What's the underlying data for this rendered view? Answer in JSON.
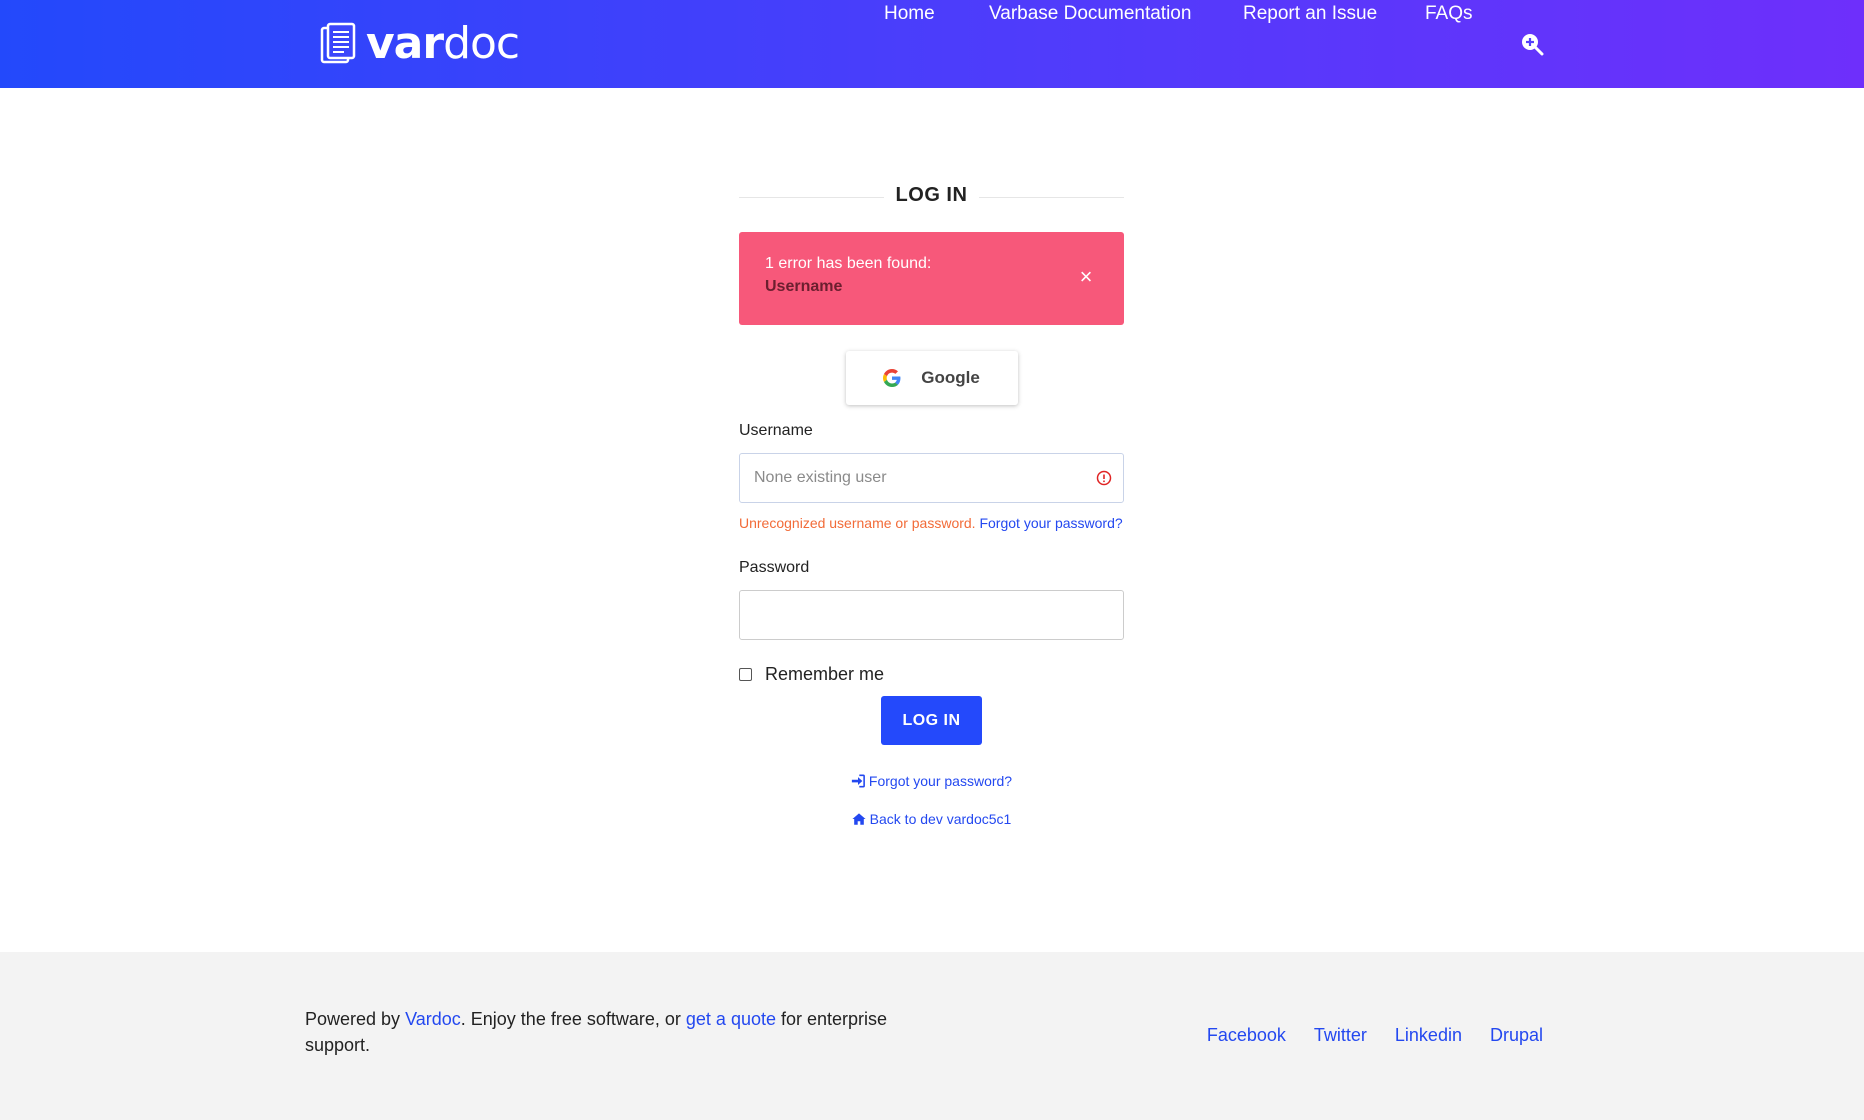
{
  "header": {
    "logo_bold": "var",
    "logo_light": "doc",
    "nav": [
      {
        "label": "Home"
      },
      {
        "label": "Varbase Documentation"
      },
      {
        "label": "Report an Issue"
      },
      {
        "label": "FAQs"
      }
    ],
    "search_icon": "search-plus-icon"
  },
  "login": {
    "title": "LOG IN",
    "alert": {
      "message": "1 error has been found:",
      "field": "Username",
      "close_symbol": "×"
    },
    "google_label": "Google",
    "username": {
      "label": "Username",
      "placeholder": "None existing user",
      "value": ""
    },
    "username_error": "Unrecognized username or password.",
    "username_error_link": "Forgot your password?",
    "password": {
      "label": "Password",
      "value": ""
    },
    "remember_label": "Remember me",
    "remember_checked": false,
    "submit_label": "LOG IN",
    "links": [
      {
        "label": "Forgot your password?",
        "icon": "sign-in-icon"
      },
      {
        "label": "Back to dev vardoc5c1",
        "icon": "home-icon"
      }
    ]
  },
  "footer": {
    "text_prefix": "Powered by",
    "vardoc_link": "Vardoc",
    "text_middle": ". Enjoy the free software, or",
    "quote_link": "get a quote",
    "text_suffix": "for enterprise support.",
    "links": [
      "Facebook",
      "Twitter",
      "Linkedin",
      "Drupal"
    ]
  },
  "colors": {
    "header_gradient_start": "#2349fb",
    "header_gradient_end": "#6e2ffb",
    "alert_bg": "#f7587a",
    "primary": "#2449fb",
    "link": "#2348f0",
    "error_text": "#f26b38",
    "footer_bg": "#f3f3f3"
  }
}
